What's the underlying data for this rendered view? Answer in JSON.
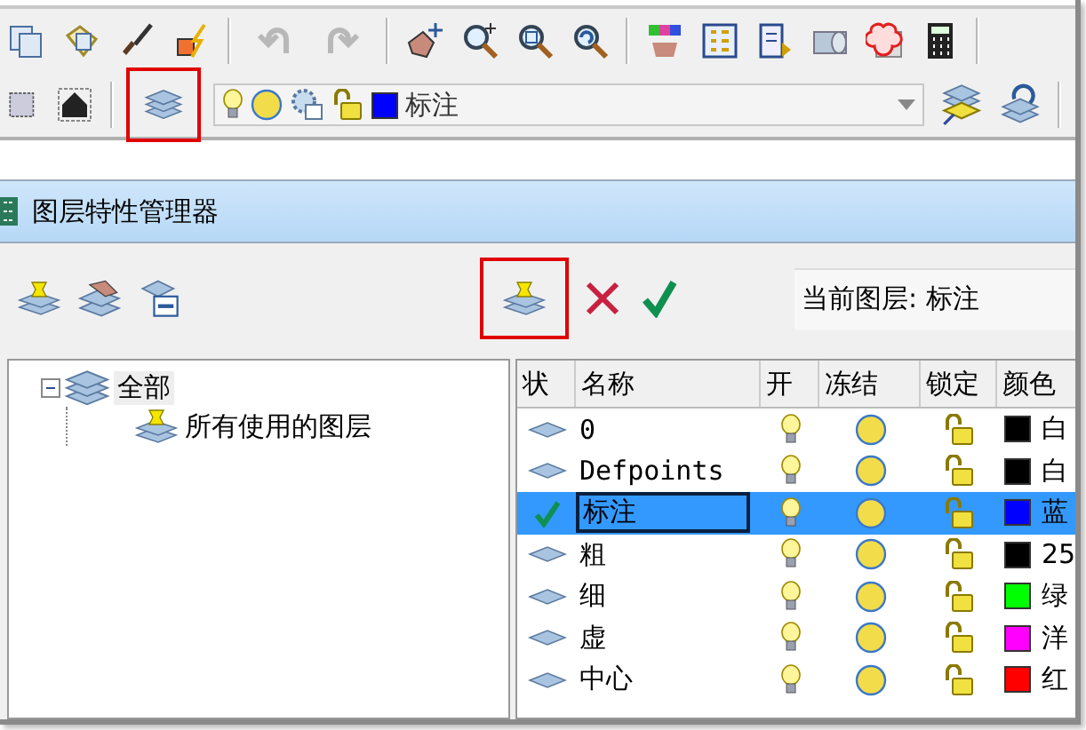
{
  "toolbar": {
    "layer_button": {
      "highlighted": true
    },
    "undo_disabled": true,
    "redo_disabled": true,
    "layer_combo": {
      "value": "标注"
    }
  },
  "dialog": {
    "title": "图层特性管理器",
    "new_layer_button": {
      "highlighted": true
    },
    "current_layer": "当前图层:  标注",
    "tree": [
      {
        "label": "全部",
        "expanded": true,
        "children": [
          {
            "label": "所有使用的图层"
          }
        ]
      }
    ],
    "table": {
      "columns": [
        "状",
        "名称",
        "开",
        "冻结",
        "锁定",
        "颜色"
      ],
      "rows": [
        {
          "name": "0",
          "current": false,
          "selected": false,
          "on": true,
          "frozen": false,
          "locked": false,
          "color": "#000000",
          "color_name": "白"
        },
        {
          "name": "Defpoints",
          "current": false,
          "selected": false,
          "on": true,
          "frozen": false,
          "locked": false,
          "color": "#000000",
          "color_name": "白"
        },
        {
          "name": "标注",
          "current": true,
          "selected": true,
          "on": true,
          "frozen": false,
          "locked": false,
          "color": "#0000ff",
          "color_name": "蓝"
        },
        {
          "name": "粗",
          "current": false,
          "selected": false,
          "on": true,
          "frozen": false,
          "locked": false,
          "color": "#000000",
          "color_name": "25"
        },
        {
          "name": "细",
          "current": false,
          "selected": false,
          "on": true,
          "frozen": false,
          "locked": false,
          "color": "#00ff00",
          "color_name": "绿"
        },
        {
          "name": "虚",
          "current": false,
          "selected": false,
          "on": true,
          "frozen": false,
          "locked": false,
          "color": "#ff00ff",
          "color_name": "洋"
        },
        {
          "name": "中心",
          "current": false,
          "selected": false,
          "on": true,
          "frozen": false,
          "locked": false,
          "color": "#ff0000",
          "color_name": "红"
        }
      ]
    }
  }
}
